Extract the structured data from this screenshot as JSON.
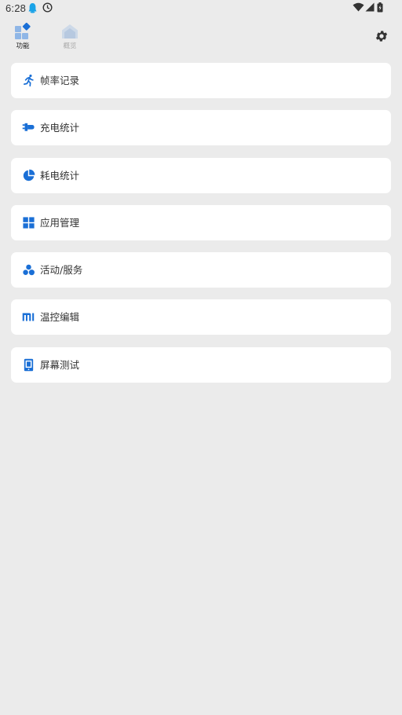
{
  "status_bar": {
    "time": "6:28",
    "icons": [
      "notification-bird-icon",
      "clock-icon",
      "wifi-icon",
      "signal-icon",
      "battery-icon"
    ]
  },
  "tabs": [
    {
      "label": "功能",
      "icon": "functions-grid-icon",
      "active": true
    },
    {
      "label": "概览",
      "icon": "overview-home-icon",
      "active": false
    }
  ],
  "settings_icon": "gear-icon",
  "menu": [
    {
      "label": "帧率记录",
      "icon": "running-person-icon"
    },
    {
      "label": "充电统计",
      "icon": "charging-plug-icon"
    },
    {
      "label": "耗电统计",
      "icon": "pie-chart-icon"
    },
    {
      "label": "应用管理",
      "icon": "apps-grid-icon"
    },
    {
      "label": "活动/服务",
      "icon": "circles-icon"
    },
    {
      "label": "温控编辑",
      "icon": "mi-logo-icon"
    },
    {
      "label": "屏幕测试",
      "icon": "phone-screen-icon"
    }
  ],
  "colors": {
    "accent": "#1a6fd6",
    "background": "#ebebeb",
    "card": "#ffffff",
    "text": "#333333"
  }
}
